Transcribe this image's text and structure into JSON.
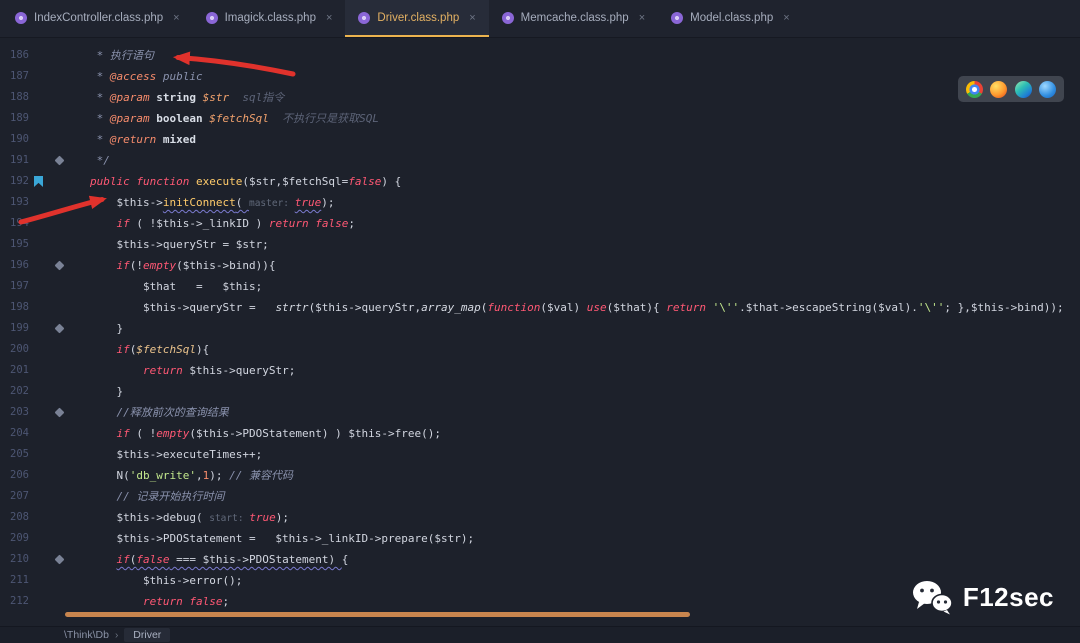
{
  "tabbar": {
    "close_glyph": "×",
    "tabs": [
      {
        "label": "IndexController.class.php",
        "active": false
      },
      {
        "label": "Imagick.class.php",
        "active": false
      },
      {
        "label": "Driver.class.php",
        "active": true
      },
      {
        "label": "Memcache.class.php",
        "active": false
      },
      {
        "label": "Model.class.php",
        "active": false
      }
    ]
  },
  "editor": {
    "lines": [
      {
        "n": "186",
        "icons": [],
        "t": [
          [
            " * 执行语句",
            "cmt"
          ]
        ]
      },
      {
        "n": "187",
        "icons": [],
        "t": [
          [
            " * ",
            "cmt"
          ],
          [
            "@access",
            "doctag"
          ],
          [
            " public",
            "cmt"
          ]
        ]
      },
      {
        "n": "188",
        "icons": [],
        "t": [
          [
            " * ",
            "cmt"
          ],
          [
            "@param",
            "doctag"
          ],
          [
            " ",
            "cmt"
          ],
          [
            "string",
            "docbold"
          ],
          [
            " ",
            "cmt"
          ],
          [
            "$str",
            "docvar"
          ],
          [
            "  sql指令",
            "cmtdim"
          ]
        ]
      },
      {
        "n": "189",
        "icons": [],
        "t": [
          [
            " * ",
            "cmt"
          ],
          [
            "@param",
            "doctag"
          ],
          [
            " ",
            "cmt"
          ],
          [
            "boolean",
            "docbold"
          ],
          [
            " ",
            "cmt"
          ],
          [
            "$fetchSql",
            "docvar"
          ],
          [
            "  不执行只是获取SQL",
            "cmtdim"
          ]
        ]
      },
      {
        "n": "190",
        "icons": [],
        "t": [
          [
            " * ",
            "cmt"
          ],
          [
            "@return",
            "doctag"
          ],
          [
            " ",
            "cmt"
          ],
          [
            "mixed",
            "docbold"
          ]
        ]
      },
      {
        "n": "191",
        "icons": [
          "diamond"
        ],
        "t": [
          [
            " */",
            "cmt"
          ]
        ]
      },
      {
        "n": "192",
        "icons": [
          "flag"
        ],
        "t": [
          [
            "public function ",
            "kw"
          ],
          [
            "execute",
            "fn"
          ],
          [
            "($str,$fetchSql=",
            "var"
          ],
          [
            "false",
            "kw"
          ],
          [
            ") {",
            "var"
          ]
        ]
      },
      {
        "n": "193",
        "icons": [],
        "t": [
          [
            "    $this->",
            "var"
          ],
          [
            "initConnect",
            "fn wavy"
          ],
          [
            "( ",
            "var wavy"
          ],
          [
            "master: ",
            "hint"
          ],
          [
            "true",
            "kw wavy"
          ],
          [
            ");",
            "var"
          ]
        ]
      },
      {
        "n": "194",
        "icons": [],
        "t": [
          [
            "    ",
            "var"
          ],
          [
            "if",
            "kw"
          ],
          [
            " ( !$this->_linkID ) ",
            "var"
          ],
          [
            "return",
            "kw"
          ],
          [
            " ",
            "var"
          ],
          [
            "false",
            "kw"
          ],
          [
            ";",
            "var"
          ]
        ]
      },
      {
        "n": "195",
        "icons": [],
        "t": [
          [
            "    $this->queryStr = $str;",
            "var"
          ]
        ]
      },
      {
        "n": "196",
        "icons": [
          "diamond"
        ],
        "t": [
          [
            "    ",
            "var"
          ],
          [
            "if",
            "kw"
          ],
          [
            "(!",
            "var"
          ],
          [
            "empty",
            "kw"
          ],
          [
            "($this->bind)){",
            "var"
          ]
        ]
      },
      {
        "n": "197",
        "icons": [],
        "t": [
          [
            "        $that   =   $this;",
            "var"
          ]
        ]
      },
      {
        "n": "198",
        "icons": [],
        "t": [
          [
            "        $this->queryStr =   ",
            "var"
          ],
          [
            "strtr",
            "bi"
          ],
          [
            "($this->queryStr,",
            "var"
          ],
          [
            "array_map",
            "bi"
          ],
          [
            "(",
            "var"
          ],
          [
            "function",
            "kw"
          ],
          [
            "($val) ",
            "var"
          ],
          [
            "use",
            "kw"
          ],
          [
            "($that){ ",
            "var"
          ],
          [
            "return",
            "kw"
          ],
          [
            " ",
            "var"
          ],
          [
            "'\\''",
            "str"
          ],
          [
            ".$that->escapeString($val).",
            "var"
          ],
          [
            "'\\''",
            "str"
          ],
          [
            "; },$this->bind));",
            "var"
          ]
        ]
      },
      {
        "n": "199",
        "icons": [
          "diamond"
        ],
        "t": [
          [
            "    }",
            "var"
          ]
        ]
      },
      {
        "n": "200",
        "icons": [],
        "t": [
          [
            "    ",
            "var"
          ],
          [
            "if",
            "kw"
          ],
          [
            "(",
            "var"
          ],
          [
            "$fetchSql",
            "param"
          ],
          [
            "){",
            "var"
          ]
        ]
      },
      {
        "n": "201",
        "icons": [],
        "t": [
          [
            "        ",
            "var"
          ],
          [
            "return",
            "kw"
          ],
          [
            " $this->queryStr;",
            "var"
          ]
        ]
      },
      {
        "n": "202",
        "icons": [],
        "t": [
          [
            "    }",
            "var"
          ]
        ]
      },
      {
        "n": "203",
        "icons": [
          "diamond"
        ],
        "t": [
          [
            "    ",
            "var"
          ],
          [
            "//释放前次的查询结果",
            "cmt"
          ]
        ]
      },
      {
        "n": "204",
        "icons": [],
        "t": [
          [
            "    ",
            "var"
          ],
          [
            "if",
            "kw"
          ],
          [
            " ( !",
            "var"
          ],
          [
            "empty",
            "kw"
          ],
          [
            "($this->PDOStatement) ) $this->free();",
            "var"
          ]
        ]
      },
      {
        "n": "205",
        "icons": [],
        "t": [
          [
            "    $this->executeTimes++;",
            "var"
          ]
        ]
      },
      {
        "n": "206",
        "icons": [],
        "t": [
          [
            "    N(",
            "var"
          ],
          [
            "'db_write'",
            "str"
          ],
          [
            ",",
            "var"
          ],
          [
            "1",
            "nm"
          ],
          [
            "); ",
            "var"
          ],
          [
            "// 兼容代码",
            "cmt"
          ]
        ]
      },
      {
        "n": "207",
        "icons": [],
        "t": [
          [
            "    ",
            "var"
          ],
          [
            "// 记录开始执行时间",
            "cmt"
          ]
        ]
      },
      {
        "n": "208",
        "icons": [],
        "t": [
          [
            "    $this->debug( ",
            "var"
          ],
          [
            "start: ",
            "hint"
          ],
          [
            "true",
            "kw"
          ],
          [
            ");",
            "var"
          ]
        ]
      },
      {
        "n": "209",
        "icons": [],
        "t": [
          [
            "    $this->PDOStatement =   $this->_linkID->prepare($str);",
            "var"
          ]
        ]
      },
      {
        "n": "210",
        "icons": [
          "diamond"
        ],
        "t": [
          [
            "    ",
            "var"
          ],
          [
            "if",
            "kw wavy"
          ],
          [
            "(",
            "var wavy"
          ],
          [
            "false",
            "kw wavy"
          ],
          [
            " === $this->PDOStatement) ",
            "var wavy"
          ],
          [
            "{",
            "var"
          ]
        ]
      },
      {
        "n": "211",
        "icons": [],
        "t": [
          [
            "        $this->error();",
            "var"
          ]
        ]
      },
      {
        "n": "212",
        "icons": [],
        "t": [
          [
            "        ",
            "var"
          ],
          [
            "return",
            "kw"
          ],
          [
            " ",
            "var"
          ],
          [
            "false",
            "kw"
          ],
          [
            ";",
            "var"
          ]
        ]
      }
    ]
  },
  "browser_toolbar": {
    "icons": [
      "chrome",
      "firefox",
      "edge",
      "blue-browser"
    ]
  },
  "statusbar": {
    "root": "\\Think\\Db",
    "chevron": "›",
    "item": "Driver"
  },
  "brand": {
    "name": "F12sec"
  },
  "colors": {
    "active_tab_underline": "#ecb44f",
    "scrollbar": "#c8854e",
    "annotation_arrow": "#e0322c",
    "editor_background": "#1d212b",
    "string_green": "#c3e88d",
    "keyword_red": "#ff5874",
    "function_yellow": "#ffcb6b"
  }
}
